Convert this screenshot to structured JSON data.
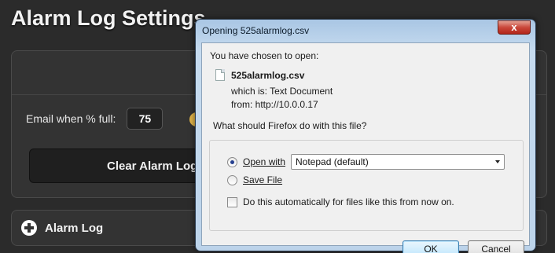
{
  "page": {
    "title": "Alarm Log Settings",
    "email_label": "Email when % full:",
    "email_value": "75",
    "clear_button": "Clear Alarm Log",
    "alarm_log_label": "Alarm Log"
  },
  "dialog": {
    "title": "Opening 525alarmlog.csv",
    "close_glyph": "x",
    "chosen_text": "You have chosen to open:",
    "filename": "525alarmlog.csv",
    "which_is": "which is:  Text Document",
    "from": "from:  http://10.0.0.17",
    "question": "What should Firefox do with this file?",
    "open_with_label": "Open with",
    "open_with_app": "Notepad (default)",
    "save_file_label": "Save File",
    "auto_label": "Do this automatically for files like this from now on.",
    "ok_label": "OK",
    "cancel_label": "Cancel",
    "selected_option": "open_with",
    "auto_checked": false
  }
}
